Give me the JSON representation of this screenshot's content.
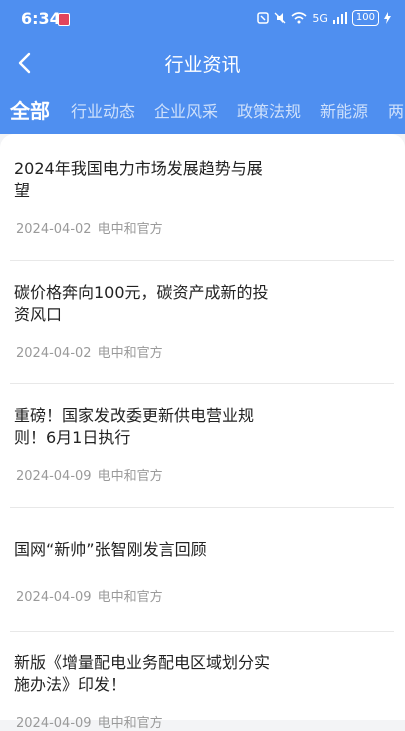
{
  "status_bar": {
    "time": "6:34",
    "network": "5G",
    "battery": "100"
  },
  "header": {
    "title": "行业资讯"
  },
  "tabs": [
    {
      "label": "全部",
      "active": true
    },
    {
      "label": "行业动态",
      "active": false
    },
    {
      "label": "企业风采",
      "active": false
    },
    {
      "label": "政策法规",
      "active": false
    },
    {
      "label": "新能源",
      "active": false
    },
    {
      "label": "两",
      "active": false
    }
  ],
  "news": [
    {
      "title": "2024年我国电力市场发展趋势与展望",
      "date": "2024-04-02",
      "source": "电中和官方"
    },
    {
      "title": "碳价格奔向100元，碳资产成新的投资风口",
      "date": "2024-04-02",
      "source": "电中和官方"
    },
    {
      "title": "重磅！国家发改委更新供电营业规则！6月1日执行",
      "date": "2024-04-09",
      "source": "电中和官方"
    },
    {
      "title": "国网“新帅”张智刚发言回顾",
      "date": "2024-04-09",
      "source": "电中和官方"
    },
    {
      "title": "新版《增量配电业务配电区域划分实施办法》印发！",
      "date": "2024-04-09",
      "source": "电中和官方"
    }
  ],
  "colors": {
    "header_bg": "#4f8ff0",
    "text": "#222222",
    "meta": "#9a9a9a"
  }
}
